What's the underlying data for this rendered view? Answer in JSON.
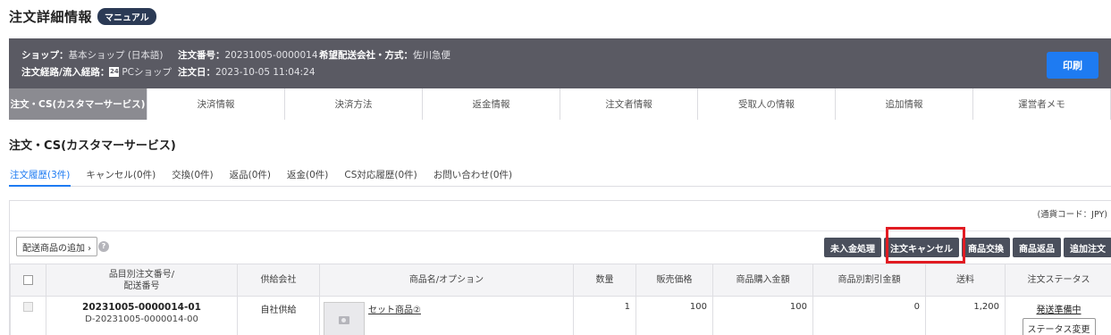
{
  "header": {
    "title": "注文詳細情報",
    "badge": "マニュアル"
  },
  "info": {
    "shop_label": "ショップ：",
    "shop_value": "基本ショップ (日本語)",
    "order_no_label": "注文番号：",
    "order_no_value": "20231005-0000014",
    "carrier_label": "希望配送会社・方式：",
    "carrier_value": "佐川急便",
    "route_label": "注文経路/流入経路：",
    "route_value": "PCショップ",
    "route_icon_text": "24",
    "date_label": "注文日：",
    "date_value": "2023-10-05 11:04:24",
    "print_label": "印刷"
  },
  "main_tabs": [
    {
      "label": "注文・CS(カスタマーサービス)"
    },
    {
      "label": "決済情報"
    },
    {
      "label": "決済方法"
    },
    {
      "label": "返金情報"
    },
    {
      "label": "注文者情報"
    },
    {
      "label": "受取人の情報"
    },
    {
      "label": "追加情報"
    },
    {
      "label": "運営者メモ"
    }
  ],
  "section_title": "注文・CS(カスタマーサービス)",
  "sub_tabs": [
    {
      "label": "注文履歴(3件)"
    },
    {
      "label": "キャンセル(0件)"
    },
    {
      "label": "交換(0件)"
    },
    {
      "label": "返品(0件)"
    },
    {
      "label": "返金(0件)"
    },
    {
      "label": "CS対応履歴(0件)"
    },
    {
      "label": "お問い合わせ(0件)"
    }
  ],
  "currency_note": "(通貨コード：JPY)",
  "toolbar": {
    "add_label": "配送商品の追加 ›",
    "help_glyph": "?",
    "actions": [
      "未入金処理",
      "注文キャンセル",
      "商品交換",
      "商品返品",
      "追加注文"
    ]
  },
  "table": {
    "headers": [
      "",
      "品目別注文番号/\n配送番号",
      "供給会社",
      "商品名/オプション",
      "数量",
      "販売価格",
      "商品購入金額",
      "商品別割引金額",
      "送料",
      "注文ステータス"
    ],
    "rows": [
      {
        "order_no": "20231005-0000014-01",
        "delivery_no": "D-20231005-0000014-00",
        "supplier": "自社供給",
        "product": "セット商品②",
        "qty": "1",
        "price": "100",
        "purchase": "100",
        "discount": "0",
        "shipping": "1,200",
        "status": "発送準備中",
        "status_button": "ステータス変更"
      }
    ]
  },
  "colors": {
    "accent": "#1e7bf2",
    "info_bar": "#5a5a63",
    "highlight": "#e11b22",
    "action_button": "#4a4f5c"
  }
}
